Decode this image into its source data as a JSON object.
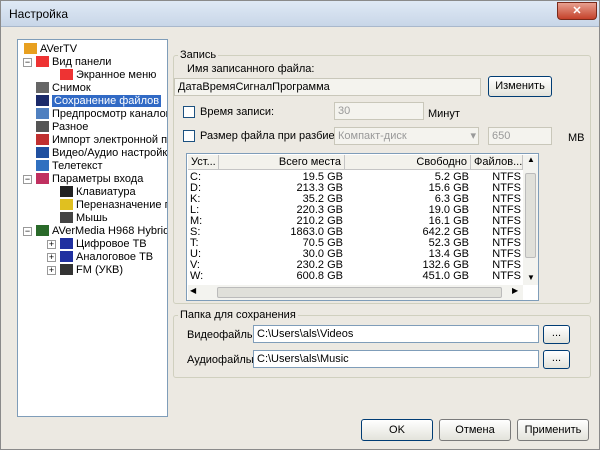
{
  "window": {
    "title": "Настройка",
    "close": "✕"
  },
  "tree": [
    {
      "label": "AVerTV",
      "level": 0,
      "icon": "avertv-icon"
    },
    {
      "label": "Вид панели",
      "level": 1,
      "icon": "panel-view-icon",
      "expander": "−"
    },
    {
      "label": "Экранное меню",
      "level": 2,
      "icon": "osd-icon"
    },
    {
      "label": "Снимок",
      "level": 1,
      "icon": "camera-icon"
    },
    {
      "label": "Сохранение файлов",
      "level": 1,
      "icon": "floppy-save-icon",
      "selected": true
    },
    {
      "label": "Предпросмотр каналов",
      "level": 1,
      "icon": "eye-icon"
    },
    {
      "label": "Разное",
      "level": 1,
      "icon": "misc-icon"
    },
    {
      "label": "Импорт электронной прог",
      "level": 1,
      "icon": "epg-import-icon"
    },
    {
      "label": "Видео/Аудио настройки",
      "level": 1,
      "icon": "tools-icon"
    },
    {
      "label": "Телетекст",
      "level": 1,
      "icon": "teletext-icon"
    },
    {
      "label": "Параметры входа",
      "level": 1,
      "icon": "input-icon",
      "expander": "−"
    },
    {
      "label": "Клавиатура",
      "level": 2,
      "icon": "keyboard-icon"
    },
    {
      "label": "Переназначение пульт",
      "level": 2,
      "icon": "remote-icon"
    },
    {
      "label": "Мышь",
      "level": 2,
      "icon": "mouse-icon"
    },
    {
      "label": "AVerMedia H968 Hybrid Ana",
      "level": 1,
      "icon": "device-icon",
      "expander": "−"
    },
    {
      "label": "Цифровое ТВ",
      "level": 2,
      "icon": "tv-icon",
      "expander": "+"
    },
    {
      "label": "Аналоговое ТВ",
      "level": 2,
      "icon": "tv-icon",
      "expander": "+"
    },
    {
      "label": "FM (УКВ)",
      "level": 2,
      "icon": "radio-icon",
      "expander": "+"
    }
  ],
  "record": {
    "legend": "Запись",
    "filename_label": "Имя записанного файла:",
    "filename_value": "ДатаВремяСигналПрограмма",
    "change_button": "Изменить",
    "time_label": "Время записи:",
    "time_value": "30",
    "time_unit": "Минут",
    "split_label": "Размер файла при разбиении:",
    "split_select": "Компакт-диск",
    "split_value": "650",
    "split_unit": "MB"
  },
  "drives": {
    "columns": [
      "Уст...",
      "Всего места",
      "Свободно",
      "Файлов..."
    ],
    "rows": [
      [
        "C:",
        "19.5 GB",
        "5.2 GB",
        "NTFS"
      ],
      [
        "D:",
        "213.3 GB",
        "15.6 GB",
        "NTFS"
      ],
      [
        "K:",
        "35.2 GB",
        "6.3 GB",
        "NTFS"
      ],
      [
        "L:",
        "220.3 GB",
        "19.0 GB",
        "NTFS"
      ],
      [
        "M:",
        "210.2 GB",
        "16.1 GB",
        "NTFS"
      ],
      [
        "S:",
        "1863.0 GB",
        "642.2 GB",
        "NTFS"
      ],
      [
        "T:",
        "70.5 GB",
        "52.3 GB",
        "NTFS"
      ],
      [
        "U:",
        "30.0 GB",
        "13.4 GB",
        "NTFS"
      ],
      [
        "V:",
        "230.2 GB",
        "132.6 GB",
        "NTFS"
      ],
      [
        "W:",
        "600.8 GB",
        "451.0 GB",
        "NTFS"
      ]
    ]
  },
  "folders": {
    "legend": "Папка для сохранения",
    "video_label": "Видеофайлы:",
    "video_value": "C:\\Users\\als\\Videos",
    "audio_label": "Аудиофайлы:",
    "audio_value": "C:\\Users\\als\\Music",
    "browse": "..."
  },
  "buttons": {
    "ok": "OK",
    "cancel": "Отмена",
    "apply": "Применить"
  }
}
